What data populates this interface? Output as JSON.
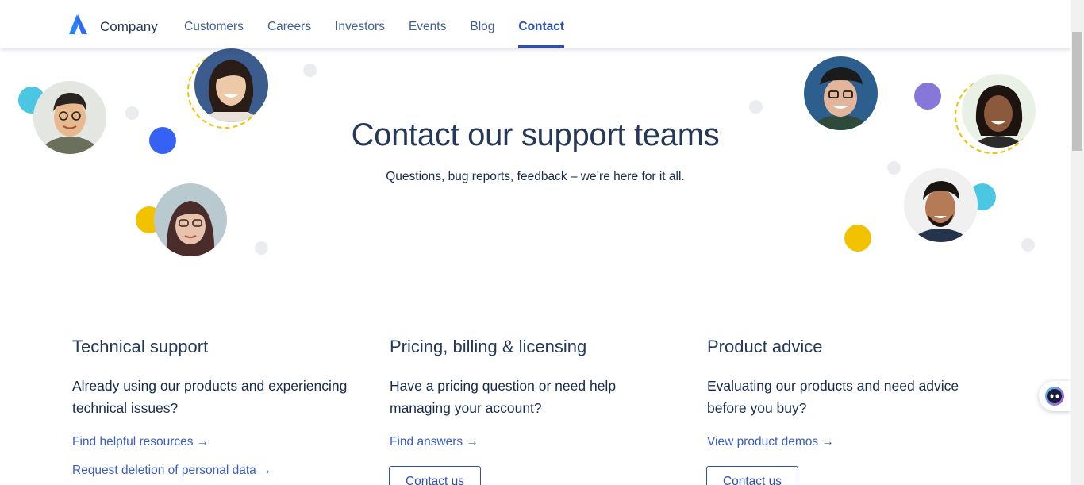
{
  "header": {
    "brand": "Company",
    "nav": [
      {
        "label": "Customers",
        "active": false
      },
      {
        "label": "Careers",
        "active": false
      },
      {
        "label": "Investors",
        "active": false
      },
      {
        "label": "Events",
        "active": false
      },
      {
        "label": "Blog",
        "active": false
      },
      {
        "label": "Contact",
        "active": true
      }
    ]
  },
  "hero": {
    "title": "Contact our support teams",
    "subtitle": "Questions, bug reports, feedback – we’re here for it all."
  },
  "columns": [
    {
      "title": "Technical support",
      "description": "Already using our products and experiencing technical issues?",
      "links": [
        "Find helpful resources →",
        "Request deletion of personal data →"
      ]
    },
    {
      "title": "Pricing, billing & licensing",
      "description": "Have a pricing question or need help managing your account?",
      "links": [
        "Find answers →"
      ],
      "button": "Contact us"
    },
    {
      "title": "Product advice",
      "description": "Evaluating our products and need advice before you buy?",
      "links": [
        "View product demos →"
      ],
      "button": "Contact us"
    }
  ],
  "colors": {
    "brand_blue": "#2f4fb5",
    "heading": "#253858",
    "link": "#3a5cc5",
    "accent_yellow": "#f2c200",
    "accent_cyan": "#4bc7e3",
    "accent_purple": "#8777d9",
    "accent_blue": "#3562f5"
  },
  "icons": {
    "logo": "company-logo-icon",
    "chat": "chat-assistant-icon"
  }
}
